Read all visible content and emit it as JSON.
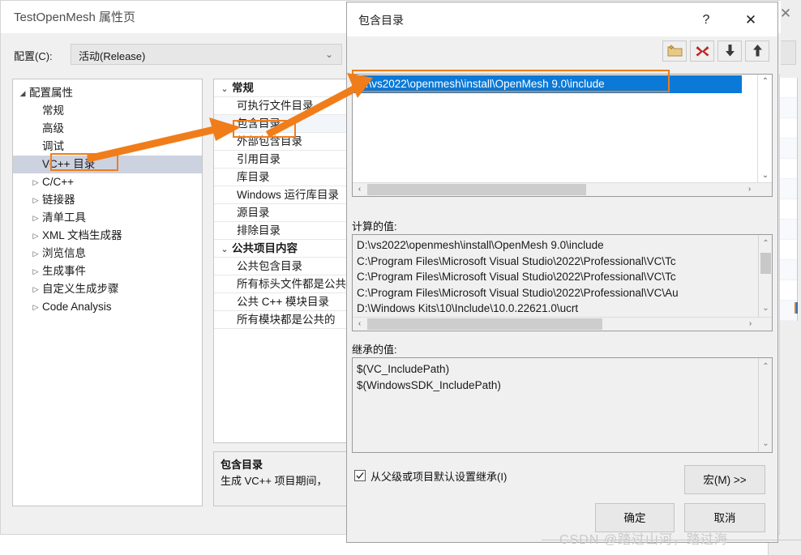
{
  "background_window": {
    "close_icon": "close-icon",
    "glyphs": {
      "close": "✕"
    }
  },
  "property_pages": {
    "title": "TestOpenMesh 属性页",
    "config": {
      "label": "配置(C):",
      "value": "活动(Release)",
      "arrow": "⌄"
    },
    "tree": {
      "items": [
        {
          "label": "配置属性",
          "level": 0,
          "twisty": "◢",
          "selected": false
        },
        {
          "label": "常规",
          "level": 1,
          "twisty": "",
          "selected": false
        },
        {
          "label": "高级",
          "level": 1,
          "twisty": "",
          "selected": false
        },
        {
          "label": "调试",
          "level": 1,
          "twisty": "",
          "selected": false
        },
        {
          "label": "VC++ 目录",
          "level": 1,
          "twisty": "",
          "selected": true
        },
        {
          "label": "C/C++",
          "level": 1,
          "twisty": "▷",
          "selected": false
        },
        {
          "label": "链接器",
          "level": 1,
          "twisty": "▷",
          "selected": false
        },
        {
          "label": "清单工具",
          "level": 1,
          "twisty": "▷",
          "selected": false
        },
        {
          "label": "XML 文档生成器",
          "level": 1,
          "twisty": "▷",
          "selected": false
        },
        {
          "label": "浏览信息",
          "level": 1,
          "twisty": "▷",
          "selected": false
        },
        {
          "label": "生成事件",
          "level": 1,
          "twisty": "▷",
          "selected": false
        },
        {
          "label": "自定义生成步骤",
          "level": 1,
          "twisty": "▷",
          "selected": false
        },
        {
          "label": "Code Analysis",
          "level": 1,
          "twisty": "▷",
          "selected": false
        }
      ]
    },
    "grid": {
      "rows": [
        {
          "label": "常规",
          "kind": "category",
          "chevron": "⌄"
        },
        {
          "label": "可执行文件目录",
          "kind": "property"
        },
        {
          "label": "包含目录",
          "kind": "property",
          "highlighted": true
        },
        {
          "label": "外部包含目录",
          "kind": "property"
        },
        {
          "label": "引用目录",
          "kind": "property"
        },
        {
          "label": "库目录",
          "kind": "property"
        },
        {
          "label": "Windows 运行库目录",
          "kind": "property"
        },
        {
          "label": "源目录",
          "kind": "property"
        },
        {
          "label": "排除目录",
          "kind": "property"
        },
        {
          "label": "公共项目内容",
          "kind": "category",
          "chevron": "⌄"
        },
        {
          "label": "公共包含目录",
          "kind": "property"
        },
        {
          "label": "所有标头文件都是公共的",
          "kind": "property"
        },
        {
          "label": "公共 C++ 模块目录",
          "kind": "property"
        },
        {
          "label": "所有模块都是公共的",
          "kind": "property"
        }
      ]
    },
    "description": {
      "title": "包含目录",
      "body": "生成 VC++ 项目期间，"
    }
  },
  "dialog": {
    "title": "包含目录",
    "help_glyph": "?",
    "close_glyph": "✕",
    "toolbar": [
      {
        "name": "new-folder-button",
        "icon": "new-folder-icon"
      },
      {
        "name": "delete-button",
        "icon": "red-x-icon"
      },
      {
        "name": "move-down-button",
        "icon": "arrow-down-icon"
      },
      {
        "name": "move-up-button",
        "icon": "arrow-up-icon"
      }
    ],
    "listbox": {
      "items": [
        "D:\\vs2022\\openmesh\\install\\OpenMesh 9.0\\include"
      ],
      "scroll_up_glyph": "⌃",
      "scroll_down_glyph": "⌄",
      "scroll_left_glyph": "‹",
      "scroll_right_glyph": "›"
    },
    "evaluated": {
      "label": "计算的值:",
      "lines": [
        "D:\\vs2022\\openmesh\\install\\OpenMesh 9.0\\include",
        "C:\\Program Files\\Microsoft Visual Studio\\2022\\Professional\\VC\\Tc",
        "C:\\Program Files\\Microsoft Visual Studio\\2022\\Professional\\VC\\Tc",
        "C:\\Program Files\\Microsoft Visual Studio\\2022\\Professional\\VC\\Au",
        "D:\\Windows Kits\\10\\Include\\10.0.22621.0\\ucrt"
      ],
      "scroll_up_glyph": "⌃",
      "scroll_down_glyph": "⌄",
      "scroll_left_glyph": "‹",
      "scroll_right_glyph": "›"
    },
    "inherited": {
      "label": "继承的值:",
      "lines": [
        "$(VC_IncludePath)",
        "$(WindowsSDK_IncludePath)"
      ],
      "scroll_up_glyph": "⌃",
      "scroll_down_glyph": "⌄"
    },
    "inherit_checkbox": {
      "label": "从父级或项目默认设置继承(I)",
      "checked": true
    },
    "buttons": {
      "macros": "宏(M) >>",
      "ok": "确定",
      "cancel": "取消"
    }
  },
  "annotations": {
    "accent_color": "#f07d1a",
    "boxes": [
      {
        "name": "tree-vcpp-dir-highlight"
      },
      {
        "name": "grid-include-dir-highlight"
      },
      {
        "name": "listbox-path-highlight"
      }
    ]
  },
  "watermark": {
    "text": "CSDN @踏过山河，踏过海"
  }
}
